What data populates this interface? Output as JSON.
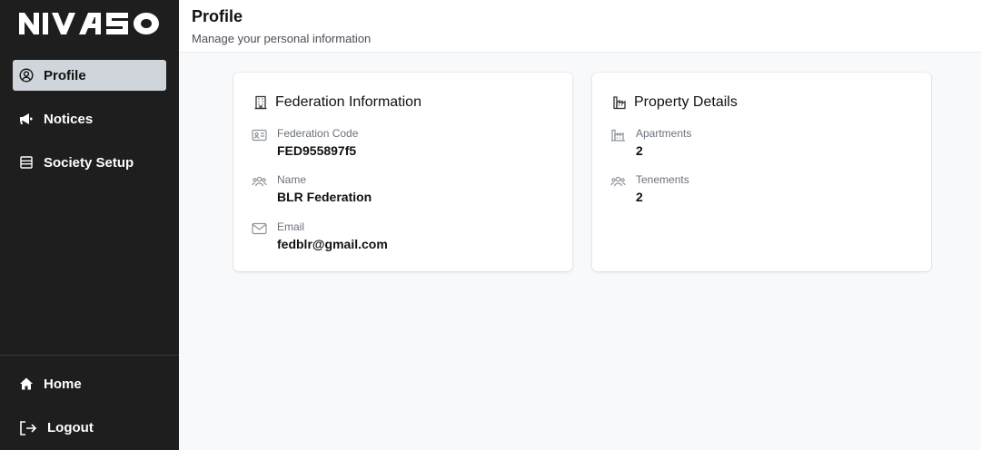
{
  "brand": {
    "logo_text": "NIVASO"
  },
  "sidebar": {
    "items": [
      {
        "label": "Profile",
        "icon": "user-circle-icon",
        "active": true
      },
      {
        "label": "Notices",
        "icon": "megaphone-icon"
      },
      {
        "label": "Society Setup",
        "icon": "list-icon"
      }
    ],
    "bottom_items": [
      {
        "label": "Home",
        "icon": "home-icon"
      },
      {
        "label": "Logout",
        "icon": "logout-icon"
      }
    ]
  },
  "header": {
    "title": "Profile",
    "subtitle": "Manage your personal information"
  },
  "federation_card": {
    "title": "Federation Information",
    "icon": "building-icon",
    "fields": [
      {
        "label": "Federation Code",
        "value": "FED955897f5",
        "icon": "id-card-icon"
      },
      {
        "label": "Name",
        "value": "BLR Federation",
        "icon": "users-icon"
      },
      {
        "label": "Email",
        "value": "fedblr@gmail.com",
        "icon": "mail-icon"
      }
    ]
  },
  "property_card": {
    "title": "Property Details",
    "icon": "factory-icon",
    "fields": [
      {
        "label": "Apartments",
        "value": "2",
        "icon": "factory-icon"
      },
      {
        "label": "Tenements",
        "value": "2",
        "icon": "users-icon"
      }
    ]
  },
  "colors": {
    "sidebar_bg": "#1e1e1e",
    "active_item_bg": "#d0d5db",
    "page_bg": "#f8f9fb",
    "card_bg": "#ffffff"
  }
}
